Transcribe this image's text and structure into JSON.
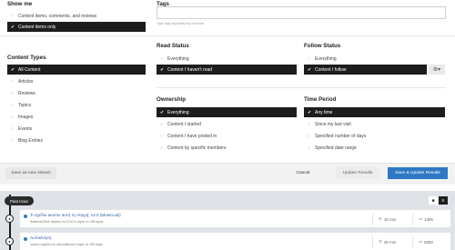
{
  "show_me": {
    "title": "Show me",
    "options": [
      {
        "label": "Content items, comments, and reviews",
        "selected": false
      },
      {
        "label": "Content items only",
        "selected": true
      }
    ]
  },
  "tags": {
    "title": "Tags",
    "placeholder": "",
    "hint": "Type tags separated by commas"
  },
  "content_types": {
    "title": "Content Types",
    "options": [
      {
        "label": "All Content",
        "selected": true
      },
      {
        "label": "Articles",
        "selected": false
      },
      {
        "label": "Reviews",
        "selected": false
      },
      {
        "label": "Topics",
        "selected": false
      },
      {
        "label": "Images",
        "selected": false
      },
      {
        "label": "Events",
        "selected": false
      },
      {
        "label": "Blog Entries",
        "selected": false
      }
    ]
  },
  "read_status": {
    "title": "Read Status",
    "options": [
      {
        "label": "Everything",
        "selected": false
      },
      {
        "label": "Content I haven't read",
        "selected": true
      }
    ]
  },
  "follow_status": {
    "title": "Follow Status",
    "options": [
      {
        "label": "Everything",
        "selected": false
      },
      {
        "label": "Content I follow",
        "selected": true
      }
    ],
    "gear_icon": "gear-icon"
  },
  "ownership": {
    "title": "Ownership",
    "options": [
      {
        "label": "Everything",
        "selected": true
      },
      {
        "label": "Content I started",
        "selected": false
      },
      {
        "label": "Content I have posted in",
        "selected": false
      },
      {
        "label": "Content by specific members",
        "selected": false
      }
    ]
  },
  "time_period": {
    "title": "Time Period",
    "options": [
      {
        "label": "Any time",
        "selected": true
      },
      {
        "label": "Since my last visit",
        "selected": false
      },
      {
        "label": "Specified number of days",
        "selected": false
      },
      {
        "label": "Specified date range",
        "selected": false
      }
    ]
  },
  "footer": {
    "save_stream": "Save as new stream",
    "cancel": "Cancel",
    "update_results": "Update Results",
    "save_update": "Save & Update Results"
  },
  "stream": {
    "time_label": "Past Hour",
    "items": [
      {
        "title": "Τι σχέδιο ακούτε αυτή τη στιγμή; v2.0 (MusicLab)",
        "subtitle": "Athens2004 replied to DJO's topic in Off topic",
        "time": "16 min",
        "replies": "1395"
      },
      {
        "title": "Αυτοκίνηση",
        "subtitle": "czarls replied to astrolabos's topic in Off topic",
        "time": "29 min",
        "replies": "5082"
      }
    ]
  },
  "colors": {
    "selected_bg": "#1d1d1d",
    "primary_button": "#2f79c4",
    "unread_dot": "#2f79c4",
    "stream_bg": "#dfe2e6"
  }
}
